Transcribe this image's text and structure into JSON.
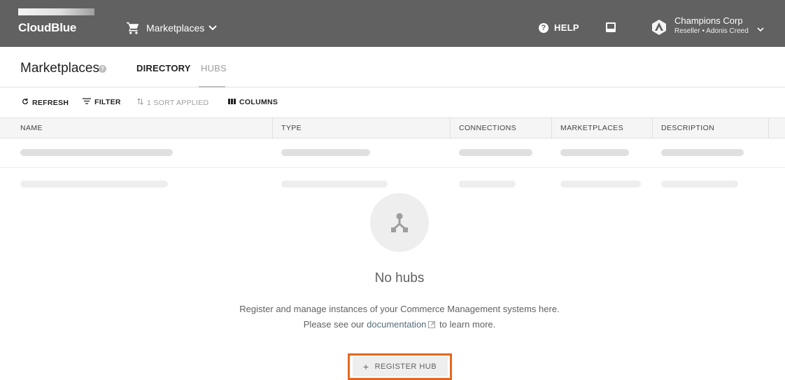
{
  "app": {
    "logo_text": "CloudBlue",
    "module_label": "Marketplaces",
    "help_label": "HELP",
    "account_name": "Champions Corp",
    "account_sub": "Reseller • Adonis Creed"
  },
  "page": {
    "title": "Marketplaces",
    "tabs": [
      {
        "label": "DIRECTORY",
        "active": false
      },
      {
        "label": "HUBS",
        "active": true
      }
    ]
  },
  "toolbar": {
    "refresh": "REFRESH",
    "filter": "FILTER",
    "sort": "1 SORT APPLIED",
    "columns": "COLUMNS"
  },
  "table": {
    "columns": [
      "NAME",
      "TYPE",
      "CONNECTIONS",
      "MARKETPLACES",
      "DESCRIPTION"
    ]
  },
  "empty_state": {
    "title": "No hubs",
    "line1": "Register and manage instances of your Commerce Management systems here.",
    "line2_before": "Please see our",
    "link": "documentation",
    "line2_after": "to learn more.",
    "button": "REGISTER HUB"
  },
  "icons": [
    "cart-icon",
    "chevron-down-icon",
    "help-icon",
    "inbox-icon",
    "account-avatar-icon",
    "refresh-icon",
    "filter-icon",
    "sort-icon",
    "columns-icon",
    "hub-icon",
    "external-link-icon",
    "plus-icon"
  ],
  "colors": {
    "topbar": "#616161",
    "highlight_border": "#e5671f",
    "link": "#546e7a"
  }
}
